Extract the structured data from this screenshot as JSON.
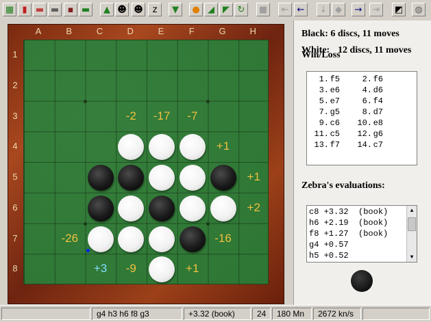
{
  "toolbar": {
    "buttons": [
      {
        "name": "new-game-icon",
        "glyph": "▦",
        "color": "#208020"
      },
      {
        "name": "open-book-icon",
        "glyph": "▮",
        "color": "#c02020"
      },
      {
        "name": "load-icon",
        "glyph": "▬",
        "color": "#c04040"
      },
      {
        "name": "copy-icon",
        "glyph": "▬",
        "color": "#606060"
      },
      {
        "name": "save-icon",
        "glyph": "▪",
        "color": "#802020"
      },
      {
        "name": "open-folder-icon",
        "glyph": "▬",
        "color": "#208020"
      },
      {
        "name": "play-icon",
        "glyph": "▲",
        "color": "#208020"
      },
      {
        "name": "person-icon",
        "glyph": "☻",
        "color": "#000000"
      },
      {
        "name": "two-players-icon",
        "glyph": "☻",
        "color": "#000000"
      },
      {
        "name": "swap-icon",
        "glyph": "z",
        "color": "#000000"
      },
      {
        "name": "download-icon",
        "glyph": "▼",
        "color": "#208020"
      },
      {
        "name": "stop-icon",
        "glyph": "●",
        "color": "#e08000"
      },
      {
        "name": "shrink-icon",
        "glyph": "◢",
        "color": "#208020"
      },
      {
        "name": "expand-icon",
        "glyph": "◤",
        "color": "#208020"
      },
      {
        "name": "rotate-icon",
        "glyph": "↻",
        "color": "#208020"
      },
      {
        "name": "square-icon",
        "glyph": "■",
        "color": "#a0a0a0"
      },
      {
        "name": "first-move-icon",
        "glyph": "⇤",
        "color": "#a0a0a0"
      },
      {
        "name": "back-icon",
        "glyph": "←",
        "color": "#000080"
      },
      {
        "name": "down-icon",
        "glyph": "↓",
        "color": "#a0a0a0"
      },
      {
        "name": "hint-icon",
        "glyph": "◆",
        "color": "#a0a0a0"
      },
      {
        "name": "forward-icon",
        "glyph": "→",
        "color": "#000080"
      },
      {
        "name": "last-move-icon",
        "glyph": "⇥",
        "color": "#a0a0a0"
      },
      {
        "name": "contrast-icon",
        "glyph": "◩",
        "color": "#000000"
      },
      {
        "name": "globe-icon",
        "glyph": "◍",
        "color": "#606060"
      }
    ]
  },
  "board": {
    "columns": [
      "A",
      "B",
      "C",
      "D",
      "E",
      "F",
      "G",
      "H"
    ],
    "rows": [
      "1",
      "2",
      "3",
      "4",
      "5",
      "6",
      "7",
      "8"
    ],
    "discs": [
      {
        "col": 3,
        "row": 3,
        "color": "white"
      },
      {
        "col": 4,
        "row": 3,
        "color": "white"
      },
      {
        "col": 5,
        "row": 3,
        "color": "white"
      },
      {
        "col": 2,
        "row": 4,
        "color": "black"
      },
      {
        "col": 3,
        "row": 4,
        "color": "black"
      },
      {
        "col": 4,
        "row": 4,
        "color": "white"
      },
      {
        "col": 5,
        "row": 4,
        "color": "white"
      },
      {
        "col": 6,
        "row": 4,
        "color": "black"
      },
      {
        "col": 2,
        "row": 5,
        "color": "black"
      },
      {
        "col": 3,
        "row": 5,
        "color": "white"
      },
      {
        "col": 4,
        "row": 5,
        "color": "black"
      },
      {
        "col": 5,
        "row": 5,
        "color": "white"
      },
      {
        "col": 6,
        "row": 5,
        "color": "white"
      },
      {
        "col": 2,
        "row": 6,
        "color": "white"
      },
      {
        "col": 3,
        "row": 6,
        "color": "white"
      },
      {
        "col": 4,
        "row": 6,
        "color": "white"
      },
      {
        "col": 5,
        "row": 6,
        "color": "black"
      },
      {
        "col": 4,
        "row": 7,
        "color": "white"
      }
    ],
    "evaluations": [
      {
        "col": 3,
        "row": 2,
        "text": "-2",
        "color": "#f0c040"
      },
      {
        "col": 4,
        "row": 2,
        "text": "-17",
        "color": "#f0c040"
      },
      {
        "col": 5,
        "row": 2,
        "text": "-7",
        "color": "#f0c040"
      },
      {
        "col": 6,
        "row": 3,
        "text": "+1",
        "color": "#f0c040"
      },
      {
        "col": 7,
        "row": 4,
        "text": "+1",
        "color": "#f0c040"
      },
      {
        "col": 7,
        "row": 5,
        "text": "+2",
        "color": "#f0c040"
      },
      {
        "col": 1,
        "row": 6,
        "text": "-26",
        "color": "#f0c040"
      },
      {
        "col": 6,
        "row": 6,
        "text": "-16",
        "color": "#f0c040"
      },
      {
        "col": 2,
        "row": 7,
        "text": "+3",
        "color": "#80e0ff"
      },
      {
        "col": 3,
        "row": 7,
        "text": "-9",
        "color": "#f0c040"
      },
      {
        "col": 5,
        "row": 7,
        "text": "+1",
        "color": "#f0c040"
      }
    ]
  },
  "panel": {
    "black_label": "Black:   6 discs, 11 moves",
    "white_overlap_left": "White:",
    "white_overlap_label": "Win/Loss",
    "white_label": "12 discs, 11 moves",
    "moves": [
      {
        "n1": " 1.",
        "m1": "f5",
        "n2": " 2.",
        "m2": "f6"
      },
      {
        "n1": " 3.",
        "m1": "e6",
        "n2": " 4.",
        "m2": "d6"
      },
      {
        "n1": " 5.",
        "m1": "e7",
        "n2": " 6.",
        "m2": "f4"
      },
      {
        "n1": " 7.",
        "m1": "g5",
        "n2": " 8.",
        "m2": "d7"
      },
      {
        "n1": " 9.",
        "m1": "c6",
        "n2": "10.",
        "m2": "e8"
      },
      {
        "n1": "11.",
        "m1": "c5",
        "n2": "12.",
        "m2": "g6"
      },
      {
        "n1": "13.",
        "m1": "f7",
        "n2": "14.",
        "m2": "c7"
      }
    ],
    "evals_title": "Zebra's evaluations:",
    "evals": [
      "c8 +3.32  (book)",
      "h6 +2.19  (book)",
      "f8 +1.27  (book)",
      "g4 +0.57",
      "h5 +0.52"
    ]
  },
  "status": {
    "principal_variation": "g4 h3 h6 f8 g3",
    "score": "+3.32 (book)",
    "depth": "24",
    "nodes": "180 Mn",
    "speed": "2672 kn/s"
  }
}
